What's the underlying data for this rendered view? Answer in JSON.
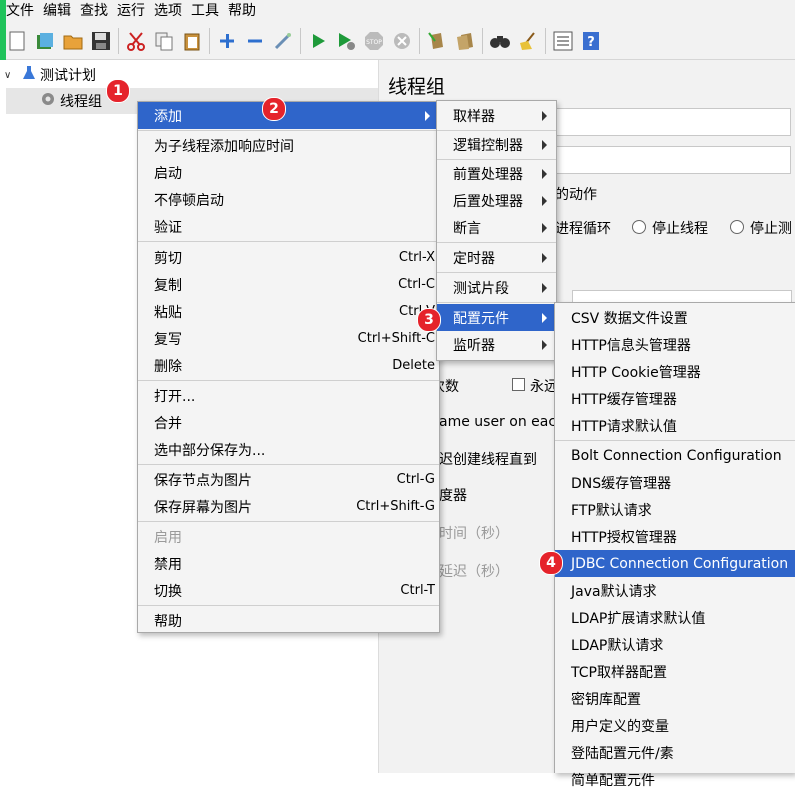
{
  "menubar": [
    "文件",
    "编辑",
    "查找",
    "运行",
    "选项",
    "工具",
    "帮助"
  ],
  "tree": {
    "root": "测试计划",
    "child": "线程组"
  },
  "right_panel": {
    "title": "线程组",
    "frag_action": "的动作",
    "radio_continue": "进程循环",
    "radio_stop_thread": "停止线程",
    "radio_stop_test": "停止测",
    "frag_count": "次数",
    "checkbox_forever": "永远",
    "frag_same_user": "ame user on each",
    "frag_delay": "迟创建线程直到",
    "frag_scheduler": "度器",
    "frag_duration": "时间（秒）",
    "frag_startup_delay": "延迟（秒）"
  },
  "context_menu": {
    "add": "添加",
    "add_resp_time": "为子线程添加响应时间",
    "start": "启动",
    "start_no_pause": "不停顿启动",
    "validate": "验证",
    "cut": "剪切",
    "cut_sc": "Ctrl-X",
    "copy": "复制",
    "copy_sc": "Ctrl-C",
    "paste": "粘贴",
    "paste_sc": "Ctrl-V",
    "duplicate": "复写",
    "duplicate_sc": "Ctrl+Shift-C",
    "delete": "删除",
    "delete_sc": "Delete",
    "open": "打开...",
    "merge": "合并",
    "save_selection": "选中部分保存为...",
    "save_node_img": "保存节点为图片",
    "save_node_img_sc": "Ctrl-G",
    "save_screen_img": "保存屏幕为图片",
    "save_screen_img_sc": "Ctrl+Shift-G",
    "enable": "启用",
    "disable": "禁用",
    "toggle": "切换",
    "toggle_sc": "Ctrl-T",
    "help": "帮助"
  },
  "add_submenu": [
    "取样器",
    "逻辑控制器",
    "前置处理器",
    "后置处理器",
    "断言",
    "定时器",
    "测试片段",
    "配置元件",
    "监听器"
  ],
  "config_submenu": [
    "CSV 数据文件设置",
    "HTTP信息头管理器",
    "HTTP Cookie管理器",
    "HTTP缓存管理器",
    "HTTP请求默认值",
    "Bolt Connection Configuration",
    "DNS缓存管理器",
    "FTP默认请求",
    "HTTP授权管理器",
    "JDBC Connection Configuration",
    "Java默认请求",
    "LDAP扩展请求默认值",
    "LDAP默认请求",
    "TCP取样器配置",
    "密钥库配置",
    "用户定义的变量",
    "登陆配置元件/素",
    "简单配置元件"
  ],
  "badges": [
    "1",
    "2",
    "3",
    "4"
  ],
  "colors": {
    "highlight": "#2f65ca",
    "badge": "#e5232b",
    "accent_green": "#20c35b"
  }
}
